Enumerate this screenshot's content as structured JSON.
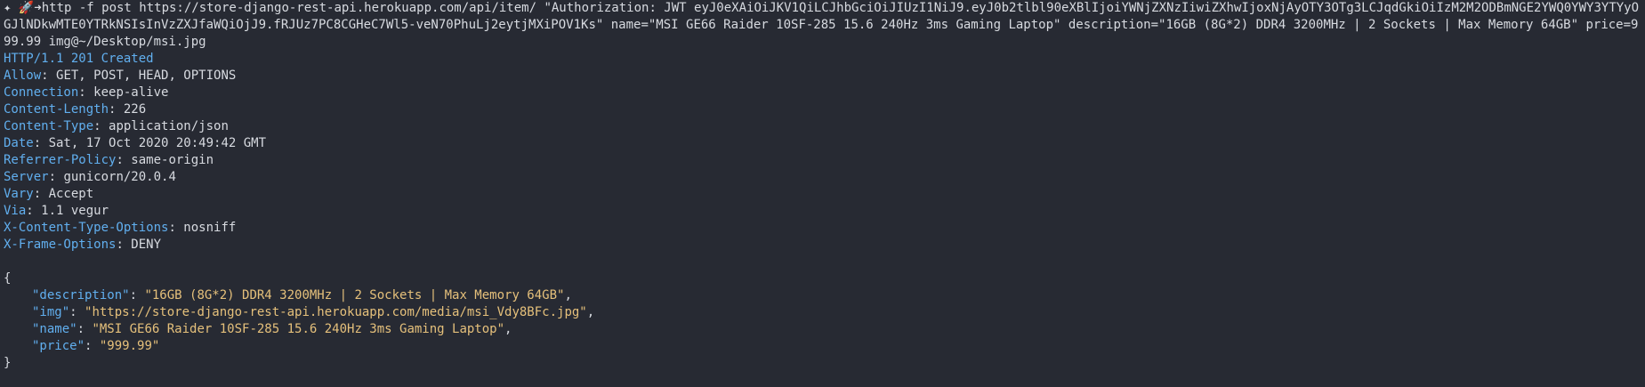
{
  "command": {
    "prompt": "✦ 🚀➜",
    "text": "http -f post https://store-django-rest-api.herokuapp.com/api/item/ \"Authorization: JWT eyJ0eXAiOiJKV1QiLCJhbGciOiJIUzI1NiJ9.eyJ0b2tlbl90eXBlIjoiYWNjZXNzIiwiZXhwIjoxNjAyOTY3OTg3LCJqdGkiOiIzM2M2ODBmNGE2YWQ0YWY3YTYyOGJlNDkwMTE0YTRkNSIsInVzZXJfaWQiOjJ9.fRJUz7PC8CGHeC7Wl5-veN70PhuLj2eytjMXiPOV1Ks\" name=\"MSI GE66 Raider 10SF-285 15.6 240Hz 3ms Gaming Laptop\" description=\"16GB (8G*2) DDR4 3200MHz | 2 Sockets | Max Memory 64GB\" price=999.99 img@~/Desktop/msi.jpg"
  },
  "status": {
    "protocol": "HTTP",
    "slash_version": "/1.1",
    "code_text": "201 Created"
  },
  "headers": [
    {
      "name": "Allow",
      "value": "GET, POST, HEAD, OPTIONS"
    },
    {
      "name": "Connection",
      "value": "keep-alive"
    },
    {
      "name": "Content-Length",
      "value": "226"
    },
    {
      "name": "Content-Type",
      "value": "application/json"
    },
    {
      "name": "Date",
      "value": "Sat, 17 Oct 2020 20:49:42 GMT"
    },
    {
      "name": "Referrer-Policy",
      "value": "same-origin"
    },
    {
      "name": "Server",
      "value": "gunicorn/20.0.4"
    },
    {
      "name": "Vary",
      "value": "Accept"
    },
    {
      "name": "Via",
      "value": "1.1 vegur"
    },
    {
      "name": "X-Content-Type-Options",
      "value": "nosniff"
    },
    {
      "name": "X-Frame-Options",
      "value": "DENY"
    }
  ],
  "body": {
    "open_brace": "{",
    "close_brace": "}",
    "fields": [
      {
        "key": "\"description\"",
        "value": "\"16GB (8G*2) DDR4 3200MHz | 2 Sockets | Max Memory 64GB\"",
        "trail": ","
      },
      {
        "key": "\"img\"",
        "value": "\"https://store-django-rest-api.herokuapp.com/media/msi_Vdy8BFc.jpg\"",
        "trail": ","
      },
      {
        "key": "\"name\"",
        "value": "\"MSI GE66 Raider 10SF-285 15.6 240Hz 3ms Gaming Laptop\"",
        "trail": ","
      },
      {
        "key": "\"price\"",
        "value": "\"999.99\"",
        "trail": ""
      }
    ]
  },
  "colors": {
    "background": "#272a33",
    "foreground": "#d7dae0",
    "header_key": "#61afef",
    "json_string": "#e5c07b"
  }
}
